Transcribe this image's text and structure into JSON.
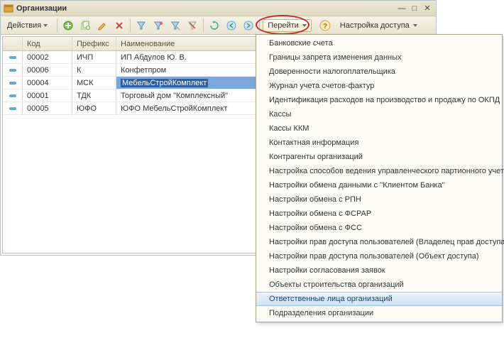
{
  "window": {
    "title": "Организации"
  },
  "toolbar": {
    "actions_label": "Действия",
    "go_label": "Перейти",
    "access_label": "Настройка доступа"
  },
  "grid": {
    "headers": {
      "code": "Код",
      "prefix": "Префикс",
      "name": "Наименование"
    },
    "rows": [
      {
        "code": "00002",
        "prefix": "ИЧП",
        "name": "ИП Абдулов Ю. В.",
        "selected": false
      },
      {
        "code": "00006",
        "prefix": "К",
        "name": "Конфетпром",
        "selected": false
      },
      {
        "code": "00004",
        "prefix": "МСК",
        "name": "МебельСтройКомплект",
        "selected": true
      },
      {
        "code": "00001",
        "prefix": "ТДК",
        "name": "Торговый дом \"Комплексный\"",
        "selected": false
      },
      {
        "code": "00005",
        "prefix": "ЮФО",
        "name": "ЮФО МебельСтройКомплект",
        "selected": false
      }
    ]
  },
  "menu": {
    "items": [
      "Банковские счета",
      "Границы запрета изменения данных",
      "Доверенности налогоплательщика",
      "Журнал учета счетов-фактур",
      "Идентификация расходов на производство и продажу по ОКПД",
      "Кассы",
      "Кассы ККМ",
      "Контактная информация",
      "Контрагенты организаций",
      "Настройка способов ведения управленческого партионного учета",
      "Настройки обмена данными с ''Клиентом Банка''",
      "Настройки обмена с РПН",
      "Настройки обмена с ФСРАР",
      "Настройки обмена с ФСС",
      "Настройки прав доступа пользователей (Владелец прав доступа)",
      "Настройки прав доступа пользователей (Объект доступа)",
      "Настройки согласования заявок",
      "Объекты строительства организаций",
      "Ответственные лица организаций",
      "Подразделения организации"
    ],
    "hover_index": 18
  }
}
